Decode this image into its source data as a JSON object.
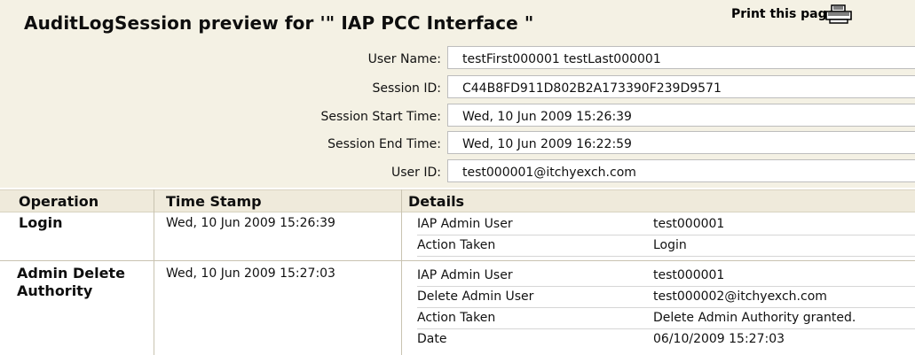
{
  "header": {
    "title": "AuditLogSession preview for '\" IAP  PCC Interface \"",
    "print_label": "Print this page"
  },
  "session_info": [
    {
      "label": "User Name:",
      "value": "testFirst000001  testLast000001"
    },
    {
      "label": "Session ID:",
      "value": "C44B8FD911D802B2A173390F239D9571"
    },
    {
      "label": "Session Start Time:",
      "value": "Wed, 10 Jun 2009 15:26:39"
    },
    {
      "label": "Session End Time:",
      "value": "Wed, 10 Jun 2009 16:22:59"
    },
    {
      "label": "User ID:",
      "value": "test000001@itchyexch.com"
    }
  ],
  "table": {
    "columns": [
      "Operation",
      "Time Stamp",
      "Details"
    ],
    "rows": [
      {
        "operation": "Login",
        "timestamp": "Wed, 10 Jun 2009 15:26:39",
        "details": [
          {
            "key": "IAP Admin User",
            "value": "test000001"
          },
          {
            "key": "Action Taken",
            "value": "Login"
          }
        ]
      },
      {
        "operation": "Admin Delete Authority",
        "timestamp": "Wed, 10 Jun 2009 15:27:03",
        "details": [
          {
            "key": "IAP Admin User",
            "value": "test000001"
          },
          {
            "key": "Delete Admin User",
            "value": "test000002@itchyexch.com"
          },
          {
            "key": "Action Taken",
            "value": "Delete Admin Authority granted."
          },
          {
            "key": "Date",
            "value": "06/10/2009 15:27:03"
          }
        ]
      }
    ]
  }
}
